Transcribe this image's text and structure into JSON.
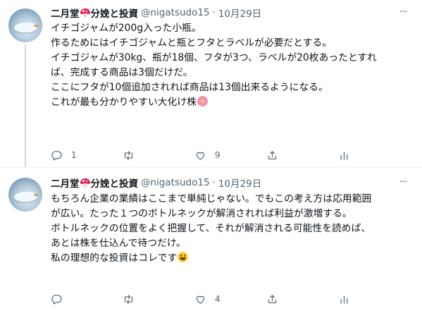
{
  "tweets": [
    {
      "display_name": "二月堂",
      "display_name_suffix": "分娩と投資",
      "handle": "@nigatsudo15",
      "separator": "·",
      "date": "10月29日",
      "more_icon": "···",
      "lines": [
        "イチゴジャムが200g入った小瓶。",
        "作るためにはイチゴジャムと瓶とフタとラベルが必要だとする。",
        "",
        "イチゴジャムが30kg、瓶が18個、フタが3つ、ラベルが20枚あったとすれ",
        "ば、完成する商品は3個だけだ。",
        "",
        "ここにフタが10個追加されれば商品は13個出来るようになる。",
        ""
      ],
      "last_line": "これが最も分かりやすい大化け株",
      "emoji": "flower-emoji",
      "replies": "1",
      "retweets": "",
      "likes": "9"
    },
    {
      "display_name": "二月堂",
      "display_name_suffix": "分娩と投資",
      "handle": "@nigatsudo15",
      "separator": "·",
      "date": "10月29日",
      "more_icon": "···",
      "lines": [
        "もちろん企業の業績はここまで単純じゃない。でもこの考え方は応用範囲",
        "が広い。たった１つのボトルネックが解消されれば利益が激増する。",
        "",
        "ボトルネックの位置をよく把握して、それが解消される可能性を読めば、",
        "あとは株を仕込んで待つだけ。",
        ""
      ],
      "last_line": "私の理想的な投資はコレです",
      "emoji": "smile-emoji",
      "replies": "",
      "retweets": "",
      "likes": "4"
    }
  ],
  "colors": {
    "text": "#0f1419",
    "secondary": "#536471",
    "thread_line": "#cfd9de"
  },
  "icons": [
    "reply-icon",
    "retweet-icon",
    "like-icon",
    "share-icon",
    "stats-icon",
    "more-icon",
    "mushroom-emoji"
  ]
}
